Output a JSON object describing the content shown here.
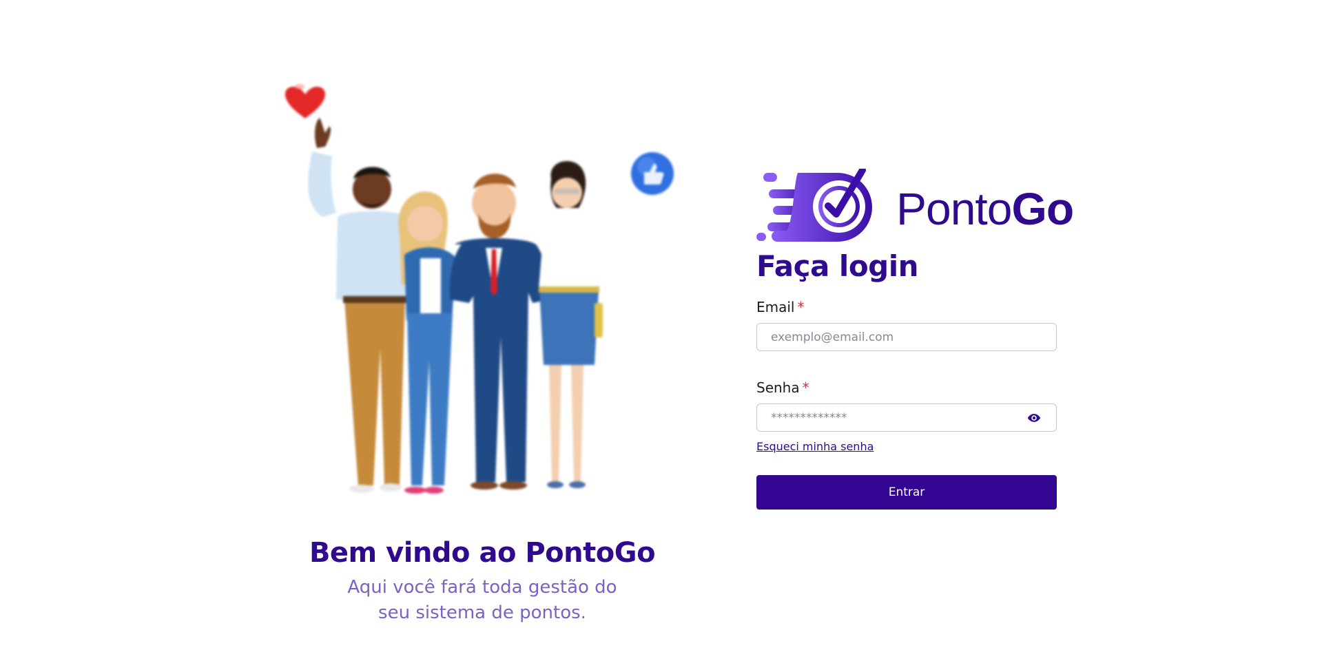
{
  "welcome": {
    "title": "Bem vindo ao PontoGo",
    "subtitle": "Aqui você fará toda gestão do seu sistema de pontos."
  },
  "illustration": {
    "icons": [
      "heart-icon",
      "thumbs-up-icon"
    ]
  },
  "brand": {
    "name_light": "Ponto",
    "name_bold": "Go",
    "primary_color": "#2f0a8f",
    "button_color": "#330593",
    "gradient_from": "#8b5cf6",
    "gradient_to": "#3b0ea8"
  },
  "login": {
    "title": "Faça login",
    "email": {
      "label": "Email",
      "required_mark": "*",
      "placeholder": "exemplo@email.com"
    },
    "password": {
      "label": "Senha",
      "required_mark": "*",
      "placeholder": "*************",
      "toggle_icon": "eye-icon"
    },
    "forgot_link": "Esqueci minha senha",
    "submit_label": "Entrar"
  }
}
